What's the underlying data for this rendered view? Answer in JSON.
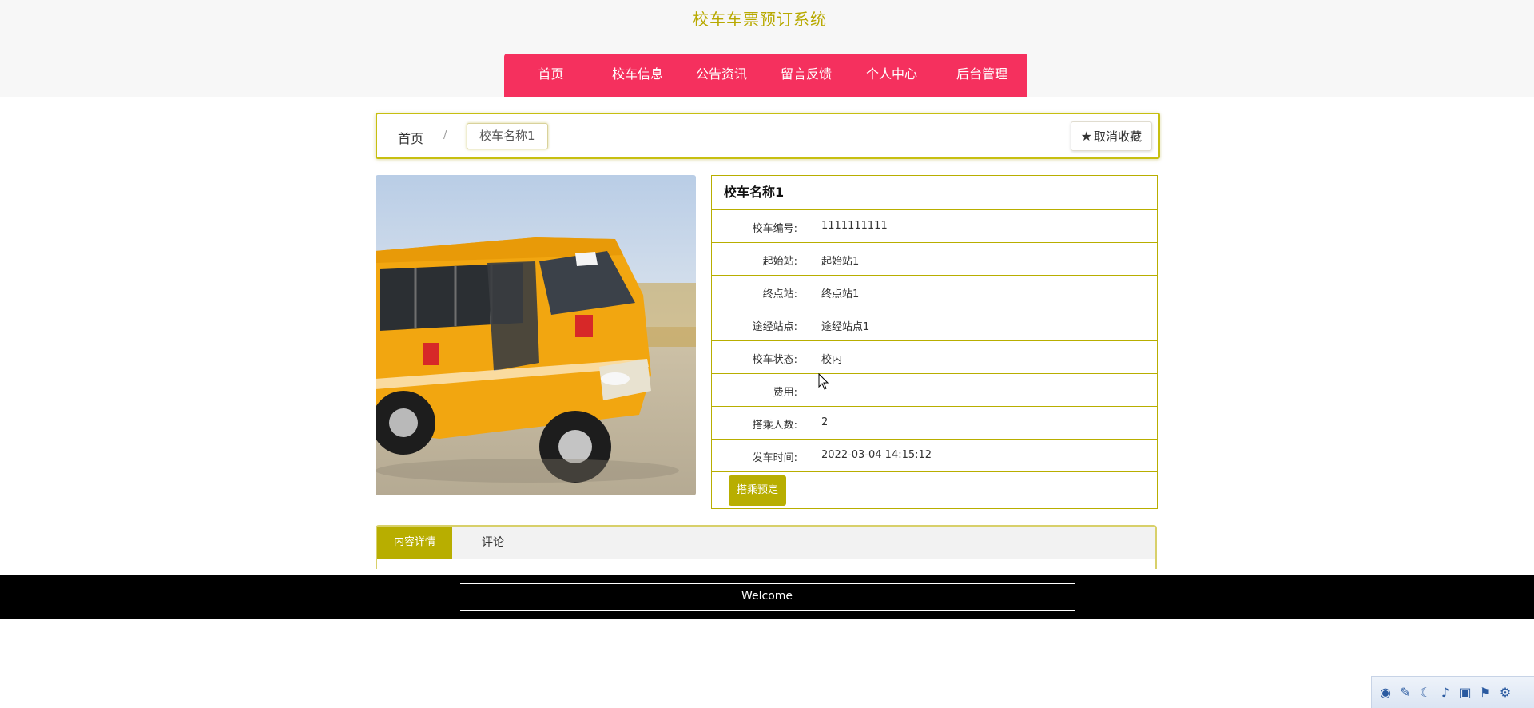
{
  "header": {
    "site_title": "校车车票预订系统",
    "nav": [
      {
        "label": "首页"
      },
      {
        "label": "校车信息"
      },
      {
        "label": "公告资讯"
      },
      {
        "label": "留言反馈"
      },
      {
        "label": "个人中心"
      },
      {
        "label": "后台管理"
      }
    ]
  },
  "breadcrumb": {
    "home": "首页",
    "separator": "/",
    "current": "校车名称1",
    "favorite_button": "取消收藏",
    "favorite_icon": "star-icon"
  },
  "detail": {
    "title": "校车名称1",
    "rows": [
      {
        "label": "校车编号:",
        "value": "1111111111"
      },
      {
        "label": "起始站:",
        "value": "起始站1"
      },
      {
        "label": "终点站:",
        "value": "终点站1"
      },
      {
        "label": "途经站点:",
        "value": "途经站点1"
      },
      {
        "label": "校车状态:",
        "value": "校内"
      },
      {
        "label": "费用:",
        "value": ""
      },
      {
        "label": "搭乘人数:",
        "value": "2"
      },
      {
        "label": "发车时间:",
        "value": "2022-03-04 14:15:12"
      }
    ],
    "book_button": "搭乘预定"
  },
  "tabs": {
    "content": "内容详情",
    "comments": "评论"
  },
  "footer": {
    "text": "Welcome"
  },
  "colors": {
    "accent": "#b8ae00",
    "nav_bg": "#f5305e",
    "title": "#b8a900",
    "footer_bg": "#000000"
  }
}
